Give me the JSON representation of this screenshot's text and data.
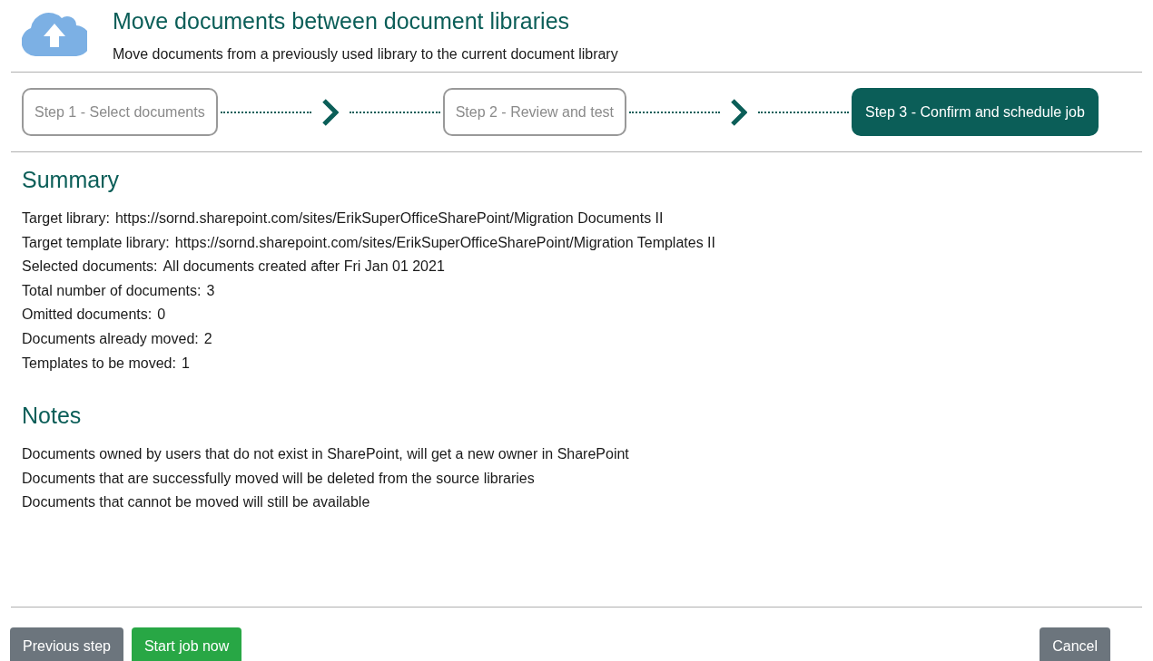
{
  "header": {
    "title": "Move documents between document libraries",
    "subtitle": "Move documents from a previously used library to the current document library"
  },
  "steps": [
    {
      "label": "Step 1 - Select documents",
      "selected": false
    },
    {
      "label": "Step 2 - Review and test",
      "selected": false
    },
    {
      "label": "Step 3 - Confirm and schedule job",
      "selected": true
    }
  ],
  "summary": {
    "heading": "Summary",
    "items": [
      {
        "label": "Target library:",
        "value": "https://sornd.sharepoint.com/sites/ErikSuperOfficeSharePoint/Migration Documents II"
      },
      {
        "label": "Target template library:",
        "value": "https://sornd.sharepoint.com/sites/ErikSuperOfficeSharePoint/Migration Templates II"
      },
      {
        "label": "Selected documents:",
        "value": "All documents created after Fri Jan 01 2021"
      },
      {
        "label": "Total number of documents:",
        "value": "3"
      },
      {
        "label": "Omitted documents:",
        "value": "0"
      },
      {
        "label": "Documents already moved:",
        "value": "2"
      },
      {
        "label": "Templates to be moved:",
        "value": "1"
      }
    ]
  },
  "notes": {
    "heading": "Notes",
    "items": [
      "Documents owned by users that do not exist in SharePoint, will get a new owner in SharePoint",
      "Documents that are successfully moved will be deleted from the source libraries",
      "Documents that cannot be moved will still be available"
    ]
  },
  "buttons": [
    {
      "label": "Previous step",
      "kind": "secondary"
    },
    {
      "label": "Start job now",
      "kind": "primary"
    },
    {
      "label": "Cancel",
      "kind": "cancel"
    }
  ]
}
